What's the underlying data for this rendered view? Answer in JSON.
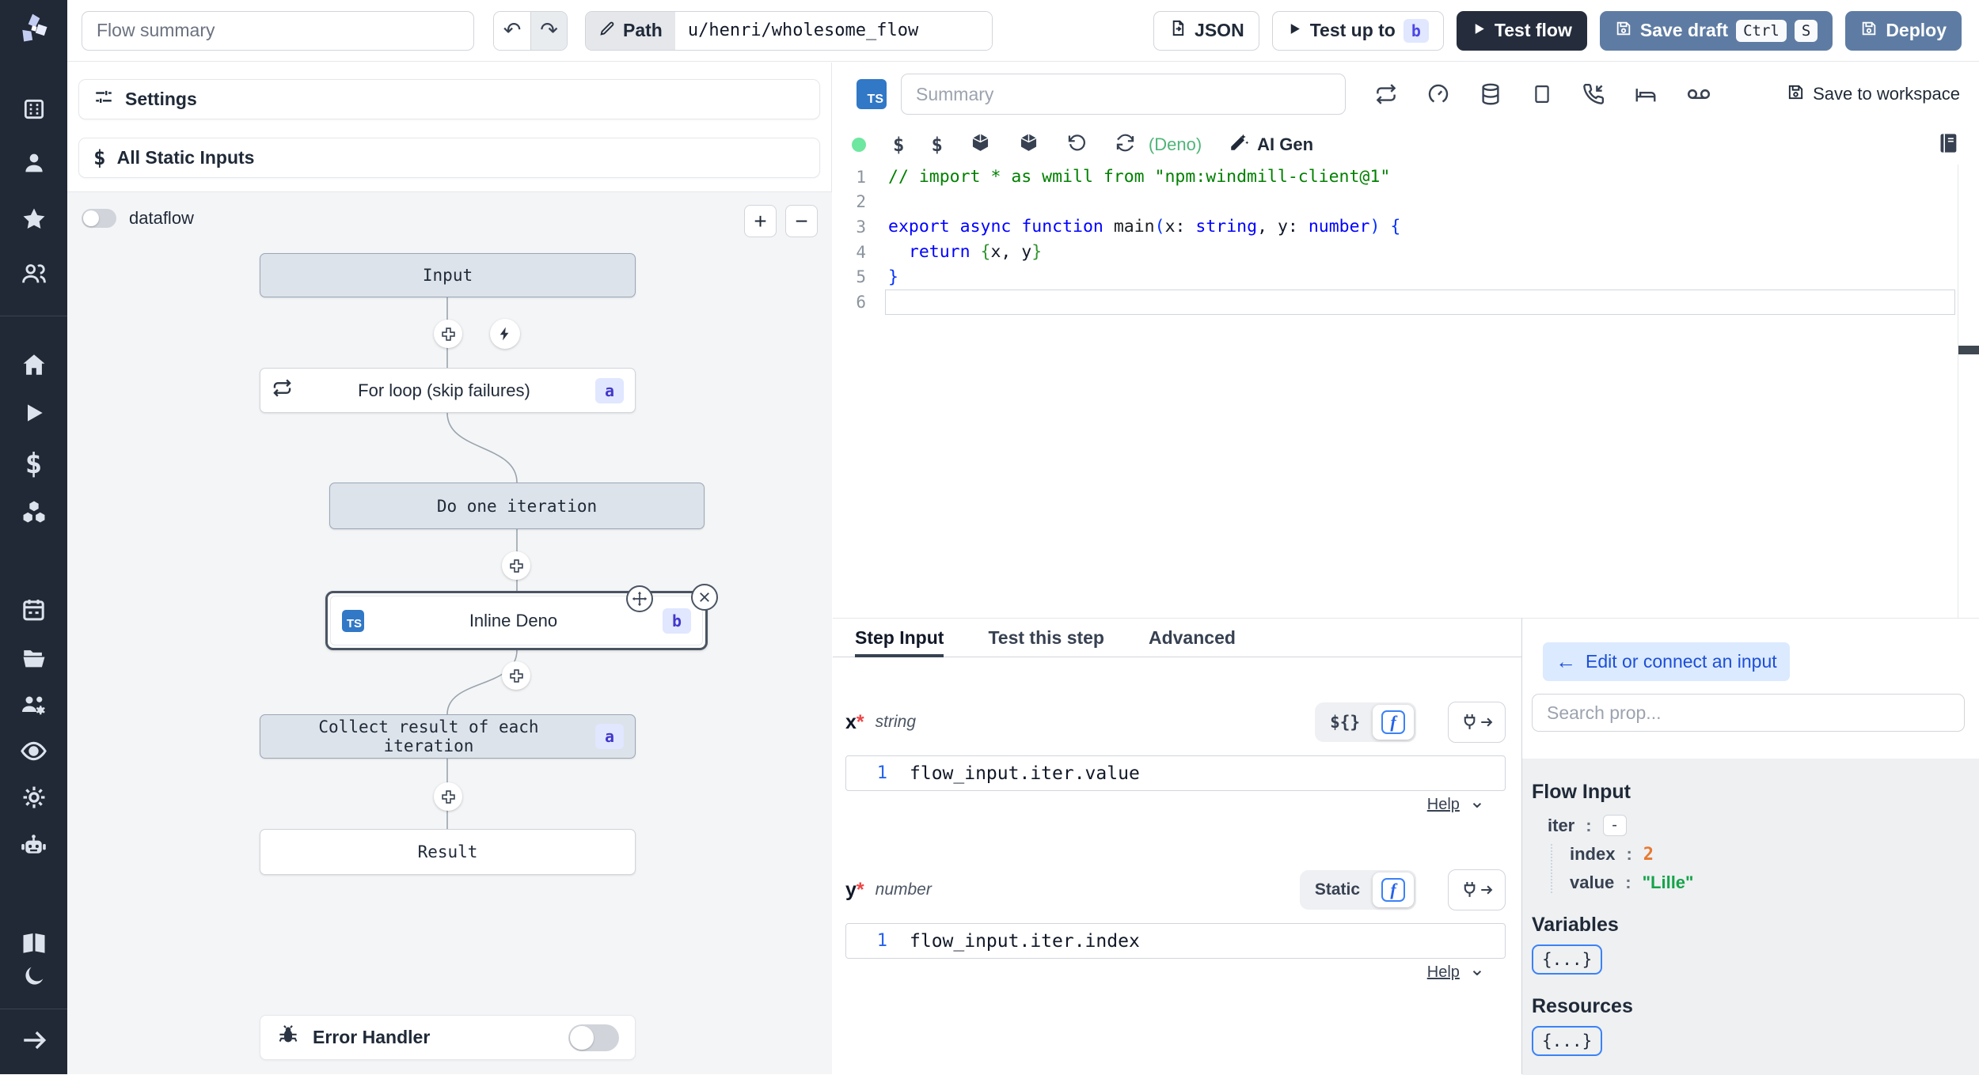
{
  "topbar": {
    "flow_summary_placeholder": "Flow summary",
    "path_label": "Path",
    "path_value": "u/henri/wholesome_flow",
    "json_button": "JSON",
    "test_up_to": "Test up to",
    "test_up_to_badge": "b",
    "test_flow": "Test flow",
    "save_draft": "Save draft",
    "kbd_ctrl": "Ctrl",
    "kbd_s": "S",
    "deploy": "Deploy"
  },
  "left_panel": {
    "settings": "Settings",
    "all_static_inputs": "All Static Inputs",
    "dataflow": "dataflow",
    "zoom_in": "+",
    "zoom_out": "−",
    "nodes": {
      "input": {
        "label": "Input"
      },
      "forloop": {
        "label": "For loop (skip failures)",
        "badge": "a"
      },
      "iteration": {
        "label": "Do one iteration"
      },
      "inline_deno": {
        "label": "Inline Deno",
        "badge": "b",
        "lang": "TS"
      },
      "collect": {
        "label": "Collect result of each iteration",
        "badge": "a"
      },
      "result": {
        "label": "Result"
      }
    },
    "error_handler": "Error Handler"
  },
  "editor": {
    "lang_badge": "TS",
    "summary_placeholder": "Summary",
    "save_to_workspace": "Save to workspace",
    "runtime": "(Deno)",
    "ai_gen": "AI Gen",
    "code_lines": [
      {
        "n": "1",
        "tokens": [
          {
            "t": "// import * as wmill from \"npm:windmill-client@1\"",
            "c": "comment"
          }
        ]
      },
      {
        "n": "2",
        "tokens": []
      },
      {
        "n": "3",
        "tokens": [
          {
            "t": "export",
            "c": "kw"
          },
          {
            "t": " ",
            "c": "pl"
          },
          {
            "t": "async",
            "c": "kw"
          },
          {
            "t": " ",
            "c": "pl"
          },
          {
            "t": "function",
            "c": "kw"
          },
          {
            "t": " ",
            "c": "pl"
          },
          {
            "t": "main",
            "c": "fn"
          },
          {
            "t": "(",
            "c": "b1"
          },
          {
            "t": "x",
            "c": "pl"
          },
          {
            "t": ": ",
            "c": "pl"
          },
          {
            "t": "string",
            "c": "type"
          },
          {
            "t": ", ",
            "c": "pl"
          },
          {
            "t": "y",
            "c": "pl"
          },
          {
            "t": ": ",
            "c": "pl"
          },
          {
            "t": "number",
            "c": "type"
          },
          {
            "t": ")",
            "c": "b1"
          },
          {
            "t": " ",
            "c": "pl"
          },
          {
            "t": "{",
            "c": "b1"
          }
        ]
      },
      {
        "n": "4",
        "tokens": [
          {
            "t": "  ",
            "c": "pl"
          },
          {
            "t": "return",
            "c": "kw"
          },
          {
            "t": " ",
            "c": "pl"
          },
          {
            "t": "{",
            "c": "b2"
          },
          {
            "t": "x, y",
            "c": "pl"
          },
          {
            "t": "}",
            "c": "b2"
          }
        ]
      },
      {
        "n": "5",
        "tokens": [
          {
            "t": "}",
            "c": "b1"
          }
        ]
      },
      {
        "n": "6",
        "tokens": [],
        "current": true
      }
    ]
  },
  "step_panel": {
    "tabs": {
      "step_input": "Step Input",
      "test_this_step": "Test this step",
      "advanced": "Advanced"
    },
    "field_x": {
      "name": "x",
      "req": "*",
      "type": "string",
      "mode": "${}",
      "line": "1",
      "expr": "flow_input.iter.value",
      "help": "Help"
    },
    "field_y": {
      "name": "y",
      "req": "*",
      "type": "number",
      "mode": "Static",
      "line": "1",
      "expr": "flow_input.iter.index",
      "help": "Help"
    }
  },
  "prop_panel": {
    "back_arrow": "←",
    "edit_connect": "Edit or connect an input",
    "search_placeholder": "Search prop...",
    "flow_input_title": "Flow Input",
    "tree": {
      "iter_key": "iter",
      "colon": ":",
      "collapse": "-",
      "index_key": "index",
      "index_value": "2",
      "value_key": "value",
      "value_value": "\"Lille\""
    },
    "variables_title": "Variables",
    "variables_button": "{...}",
    "resources_title": "Resources",
    "resources_button": "{...}"
  },
  "icons": {
    "undo": "↶",
    "redo": "↷",
    "chevron_down": "⌄"
  },
  "colors": {
    "sidebar_bg": "#212836",
    "action_blue": "#5e7ca3",
    "dark_button": "#252d3d",
    "ts_blue": "#3178c6",
    "badge_bg": "#e0e7ff",
    "badge_text": "#4338ca",
    "status_green": "#6ee7a0",
    "deno_green": "#4fb579",
    "number_orange": "#e8782e",
    "string_green": "#16a34a",
    "link_blue": "#1d4ed8",
    "f_icon_blue": "#3b82f6"
  }
}
